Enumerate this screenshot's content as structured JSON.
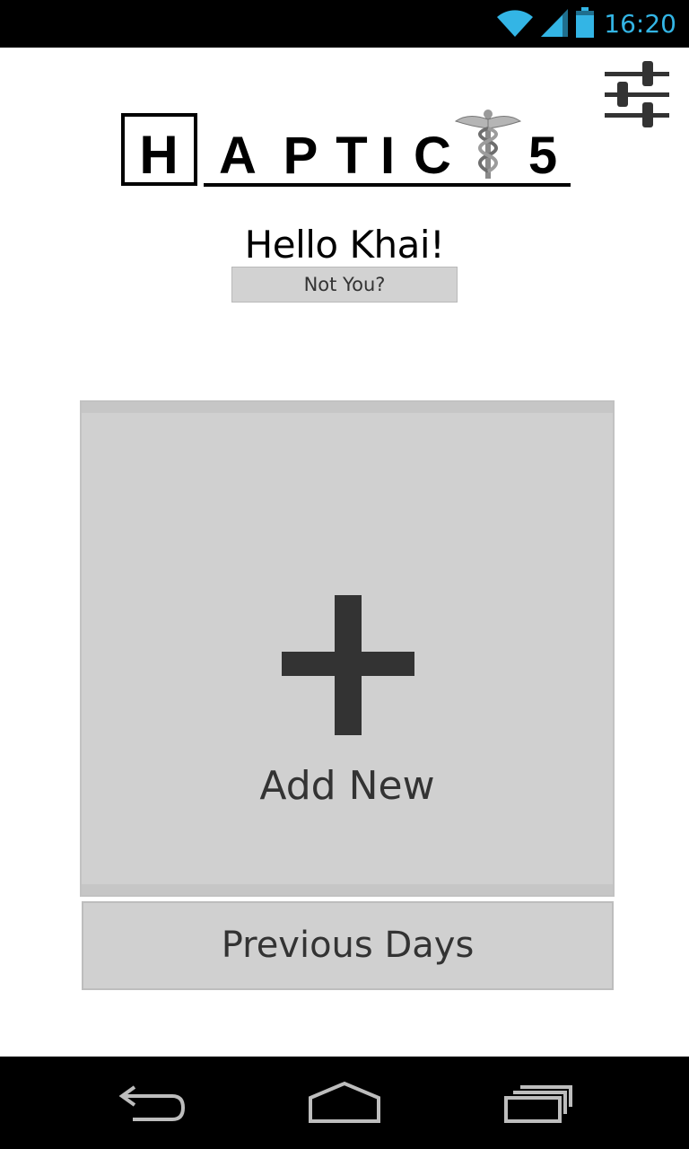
{
  "status_bar": {
    "time": "16:20",
    "icons": [
      "wifi-icon",
      "cell-signal-icon",
      "battery-icon"
    ],
    "accent_color": "#33b5e5"
  },
  "header": {
    "logo": {
      "letters": [
        "H",
        "A",
        "P",
        "T",
        "I",
        "C",
        "5"
      ],
      "emblem": "caduceus-icon"
    },
    "settings_icon": "sliders-icon"
  },
  "greeting": {
    "text": "Hello Khai!",
    "not_you_label": "Not You?"
  },
  "main": {
    "add_new_icon": "plus-icon",
    "add_new_label": "Add New",
    "previous_days_label": "Previous Days"
  },
  "nav_bar": {
    "buttons": [
      "back-icon",
      "home-icon",
      "recent-apps-icon"
    ]
  },
  "colors": {
    "tile_background": "#d0d0d0",
    "text_dark": "#333333",
    "bars": "#000000"
  }
}
